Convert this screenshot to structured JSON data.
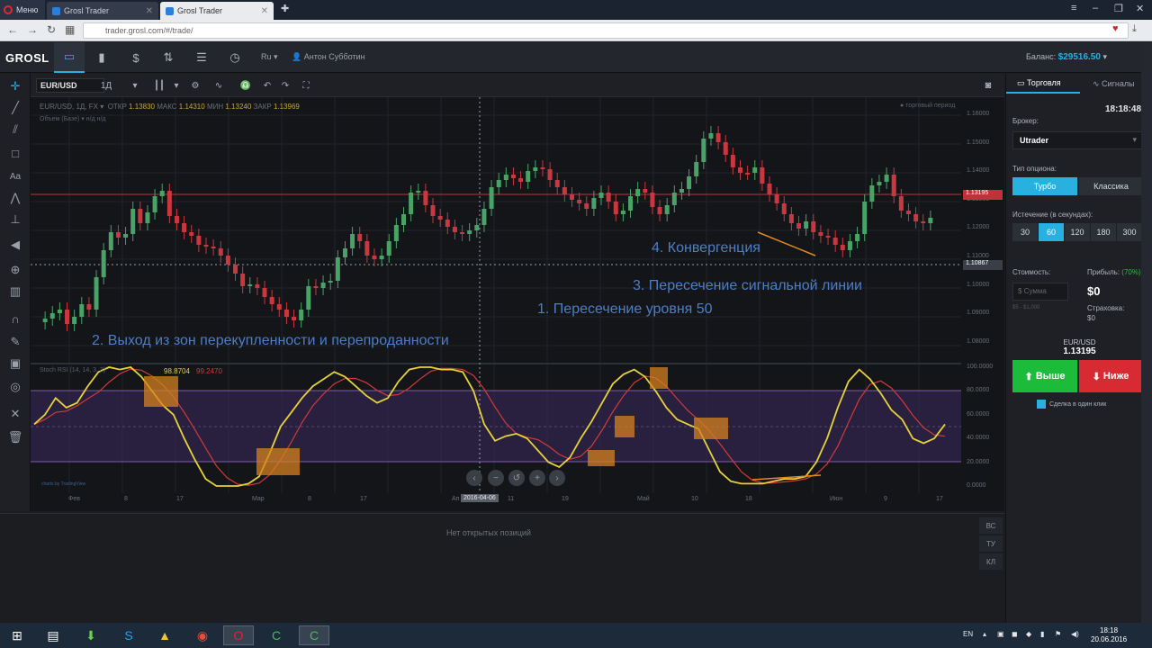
{
  "browser": {
    "menu_label": "Меню",
    "tabs": [
      {
        "title": "Grosl Trader",
        "active": false
      },
      {
        "title": "Grosl Trader",
        "active": true
      }
    ],
    "url": "trader.grosl.com/#/trade/"
  },
  "header": {
    "logo": "GROSL",
    "lang": "Ru ▾",
    "user": "Антон Субботин",
    "balance_label": "Баланс:",
    "balance_value": "$29516.50",
    "nav_icons": [
      "monitor-icon",
      "bar-chart-icon",
      "dollar-icon",
      "arrows-icon",
      "sliders-icon",
      "clock-icon"
    ]
  },
  "chart_toolbar": {
    "symbol": "EUR/USD",
    "interval": "1Д"
  },
  "chart": {
    "ohlc_text": "EUR/USD, 1Д, FX ▾",
    "open_label": "ОТКР",
    "open": "1.13830",
    "high_label": "МАКС",
    "high": "1.14310",
    "low_label": "МИН",
    "low": "1.13240",
    "close_label": "ЗАКР",
    "close": "1.13969",
    "volume_label": "Объем (Базе) ▾",
    "volume_na": "н/д  н/д",
    "period_label": "● торговый период",
    "stoch_label": "Stoch RSI (14, 14, 3, 3)",
    "stoch_k": "98.8704",
    "stoch_d": "99.2470",
    "credit": "charts by TradingView",
    "price_badge_1": "1.13195",
    "price_badge_2": "1.10867",
    "cursor_date": "2016-04-06",
    "y_ticks": [
      "1.16000",
      "1.15000",
      "1.14000",
      "1.13000",
      "1.12000",
      "1.11000",
      "1.10000",
      "1.09000",
      "1.08000"
    ],
    "stoch_ticks": [
      "100.0000",
      "80.0000",
      "60.0000",
      "40.0000",
      "20.0000",
      "0.0000"
    ],
    "x_ticks": [
      "Фев",
      "8",
      "17",
      "Мар",
      "8",
      "17",
      "Ап",
      "11",
      "19",
      "Май",
      "10",
      "18",
      "Июн",
      "9",
      "17"
    ]
  },
  "annotations": {
    "a1": "1. Пересечение уровня 50",
    "a2": "2. Выход из зон перекупленности и перепроданности",
    "a3": "3. Пересечение сигнальной линии",
    "a4": "4. Конвергенция"
  },
  "positions": {
    "empty_text": "Нет открытых позиций",
    "side_tabs": [
      "ВС",
      "ТУ",
      "КЛ"
    ]
  },
  "trade_panel": {
    "tab_trade": "Торговля",
    "tab_signals": "Сигналы",
    "time": "18:18:48",
    "broker_label": "Брокер:",
    "broker_value": "Utrader",
    "option_type_label": "Тип опциона:",
    "option_turbo": "Турбо",
    "option_classic": "Классика",
    "expiry_label": "Истечение (в секундах):",
    "expiry_options": [
      "30",
      "60",
      "120",
      "180",
      "300"
    ],
    "expiry_selected": "60",
    "cost_label": "Стоимость:",
    "sum_placeholder": "$ Сумма",
    "range": "$5 - $1,000",
    "profit_label": "Прибыль:",
    "profit_pct": "(70%)",
    "profit_value": "$0",
    "insurance_label": "Страховка:",
    "insurance_value": "$0",
    "pair": "EUR/USD",
    "price": "1.13195",
    "up_label": "Выше",
    "down_label": "Ниже",
    "one_click": "Сделка в один клик"
  },
  "taskbar": {
    "lang": "EN",
    "time": "18:18",
    "date": "20.06.2016"
  },
  "colors": {
    "accent": "#27b0e0",
    "up": "#1cbc3a",
    "down": "#d72a32",
    "annotation": "#4d7ec8",
    "stoch_k": "#e7d23a",
    "stoch_d": "#d13a3a"
  }
}
